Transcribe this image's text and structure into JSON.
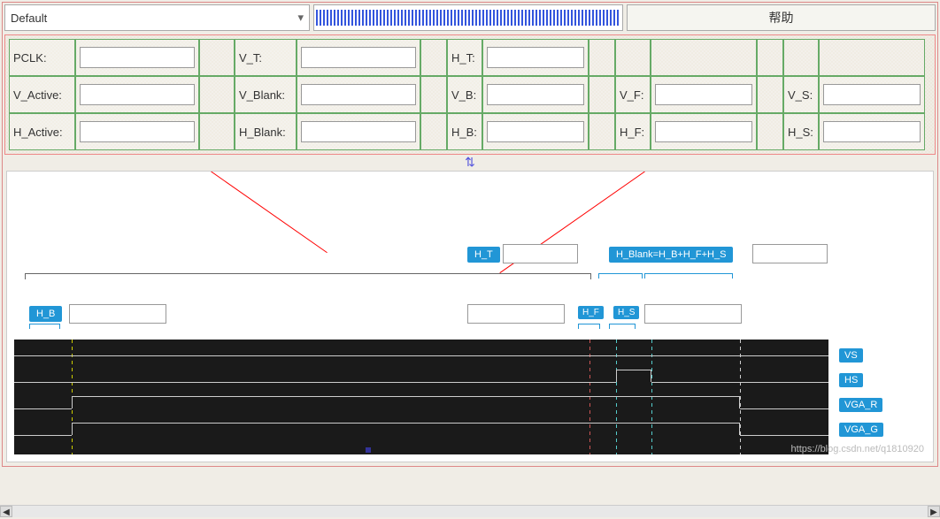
{
  "toolbar": {
    "dropdown_value": "Default",
    "help_label": "帮助"
  },
  "form": {
    "row1": {
      "pclk_label": "PCLK:",
      "vt_label": "V_T:",
      "ht_label": "H_T:"
    },
    "row2": {
      "vactive_label": "V_Active:",
      "vblank_label": "V_Blank:",
      "vb_label": "V_B:",
      "vf_label": "V_F:",
      "vs_label": "V_S:"
    },
    "row3": {
      "hactive_label": "H_Active:",
      "hblank_label": "H_Blank:",
      "hb_label": "H_B:",
      "hf_label": "H_F:",
      "hs_label": "H_S:"
    }
  },
  "diagram": {
    "ht_tag": "H_T",
    "hblank_eq": "H_Blank=H_B+H_F+H_S",
    "hb_tag": "H_B",
    "hf_tag": "H_F",
    "hs_tag": "H_S",
    "signals": {
      "vs": "VS",
      "hs": "HS",
      "vga_r": "VGA_R",
      "vga_g": "VGA_G"
    }
  },
  "chart_data": {
    "type": "timing-diagram",
    "signals": [
      "VS",
      "HS",
      "VGA_R",
      "VGA_G"
    ],
    "annotations": [
      "H_T",
      "H_Blank=H_B+H_F+H_S",
      "H_B",
      "H_F",
      "H_S"
    ],
    "interval_relation": "H_Blank = H_B + H_F + H_S"
  },
  "watermark": "https://blog.csdn.net/q1810920"
}
